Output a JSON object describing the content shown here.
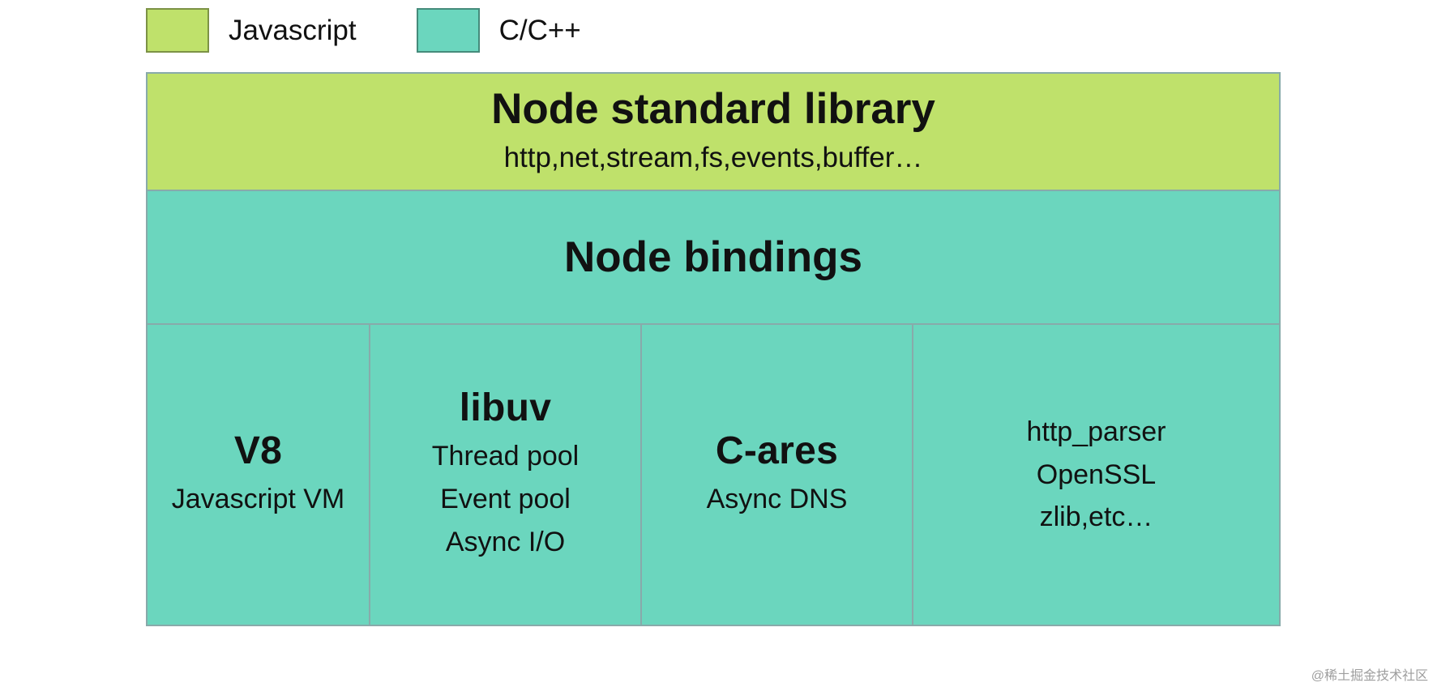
{
  "legend": {
    "items": [
      {
        "label": "Javascript",
        "color": "#bfe16b"
      },
      {
        "label": "C/C++",
        "color": "#6bd6be"
      }
    ]
  },
  "layers": {
    "stdlib": {
      "title": "Node standard library",
      "subtitle": "http,net,stream,fs,events,buffer…"
    },
    "bindings": {
      "title": "Node bindings"
    },
    "bottom": {
      "cells": [
        {
          "title": "V8",
          "lines": [
            "Javascript VM"
          ]
        },
        {
          "title": "libuv",
          "lines": [
            "Thread pool",
            "Event pool",
            "Async I/O"
          ]
        },
        {
          "title": "C-ares",
          "lines": [
            "Async DNS"
          ]
        },
        {
          "title": "",
          "lines": [
            "http_parser",
            "OpenSSL",
            "zlib,etc…"
          ]
        }
      ]
    }
  },
  "watermark": "@稀土掘金技术社区"
}
